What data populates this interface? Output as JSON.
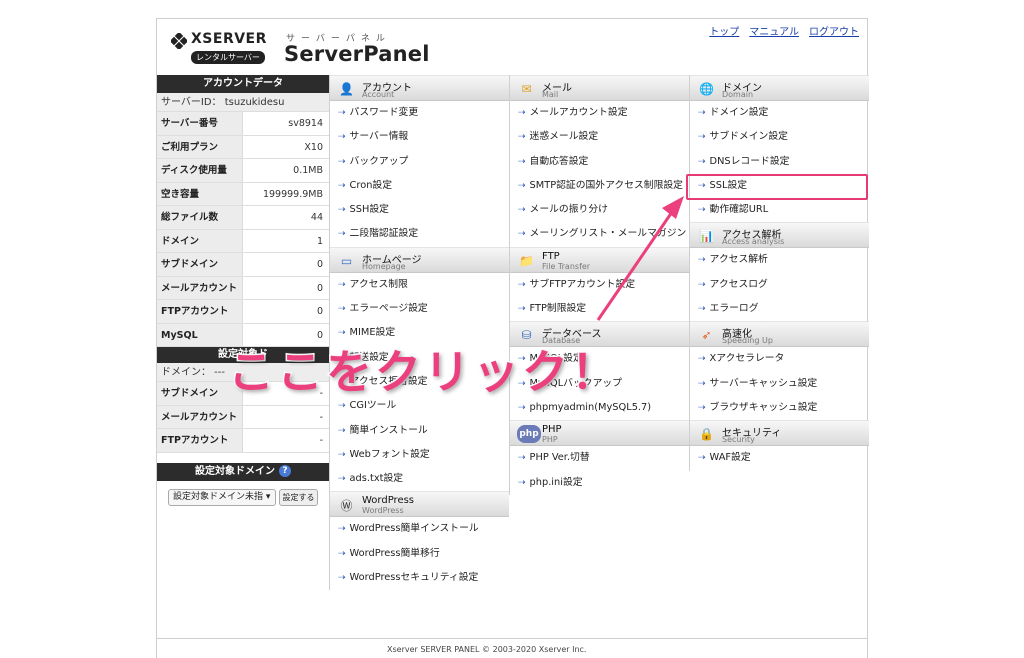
{
  "header": {
    "brand": "XSERVER",
    "badge": "レンタルサーバー",
    "kana": "サーバーパネル",
    "product": "ServerPanel",
    "links": [
      "トップ",
      "マニュアル",
      "ログアウト"
    ]
  },
  "account": {
    "title": "アカウントデータ",
    "server_id": "サーバーID： tsuzukidesu",
    "rows": [
      {
        "label": "サーバー番号",
        "value": "sv8914"
      },
      {
        "label": "ご利用プラン",
        "value": "X10"
      },
      {
        "label": "ディスク使用量",
        "value": "0.1MB"
      },
      {
        "label": "空き容量",
        "value": "199999.9MB"
      },
      {
        "label": "総ファイル数",
        "value": "44"
      },
      {
        "label": "ドメイン",
        "value": "1"
      },
      {
        "label": "サブドメイン",
        "value": "0"
      },
      {
        "label": "メールアカウント",
        "value": "0"
      },
      {
        "label": "FTPアカウント",
        "value": "0"
      },
      {
        "label": "MySQL",
        "value": "0"
      }
    ]
  },
  "target": {
    "title": "設定対象ド",
    "domain_label": "ドメイン： ---",
    "rows": [
      {
        "label": "サブドメイン",
        "value": "-"
      },
      {
        "label": "メールアカウント",
        "value": "-"
      },
      {
        "label": "FTPアカウント",
        "value": "-"
      }
    ]
  },
  "target_domain": {
    "title": "設定対象ドメイン",
    "help": "?",
    "select_value": "設定対象ドメイン未指",
    "button": "設定する"
  },
  "menu": {
    "account": {
      "jp": "アカウント",
      "en": "Account",
      "items": [
        "パスワード変更",
        "サーバー情報",
        "バックアップ",
        "Cron設定",
        "SSH設定",
        "二段階認証設定"
      ]
    },
    "homepage": {
      "jp": "ホームページ",
      "en": "Homepage",
      "items": [
        "アクセス制限",
        "エラーページ設定",
        "MIME設定",
        "転送設定",
        "アクセス拒否設定",
        "CGIツール",
        "簡単インストール",
        "Webフォント設定",
        "ads.txt設定"
      ]
    },
    "wordpress": {
      "jp": "WordPress",
      "en": "WordPress",
      "items": [
        "WordPress簡単インストール",
        "WordPress簡単移行",
        "WordPressセキュリティ設定"
      ]
    },
    "mail": {
      "jp": "メール",
      "en": "Mail",
      "items": [
        "メールアカウント設定",
        "迷惑メール設定",
        "自動応答設定",
        "SMTP認証の国外アクセス制限設定",
        "メールの振り分け",
        "メーリングリスト・メールマガジン"
      ]
    },
    "ftp": {
      "jp": "FTP",
      "en": "File Transfer",
      "items": [
        "サブFTPアカウント設定",
        "FTP制限設定"
      ]
    },
    "database": {
      "jp": "データベース",
      "en": "Database",
      "items": [
        "MySQL設定",
        "MySQLバックアップ",
        "phpmyadmin(MySQL5.7)"
      ]
    },
    "php": {
      "jp": "PHP",
      "en": "PHP",
      "items": [
        "PHP Ver.切替",
        "php.ini設定"
      ]
    },
    "domain": {
      "jp": "ドメイン",
      "en": "Domain",
      "items": [
        "ドメイン設定",
        "サブドメイン設定",
        "DNSレコード設定",
        "SSL設定",
        "動作確認URL"
      ]
    },
    "access": {
      "jp": "アクセス解析",
      "en": "Access analysis",
      "items": [
        "アクセス解析",
        "アクセスログ",
        "エラーログ"
      ]
    },
    "speed": {
      "jp": "高速化",
      "en": "Speeding Up",
      "items": [
        "Xアクセラレータ",
        "サーバーキャッシュ設定",
        "ブラウザキャッシュ設定"
      ]
    },
    "security": {
      "jp": "セキュリティ",
      "en": "Security",
      "items": [
        "WAF設定"
      ]
    }
  },
  "footer": "Xserver SERVER PANEL © 2003-2020 Xserver Inc.",
  "annotation": {
    "text": "ここをクリック！",
    "color": "#ec3f7d"
  }
}
